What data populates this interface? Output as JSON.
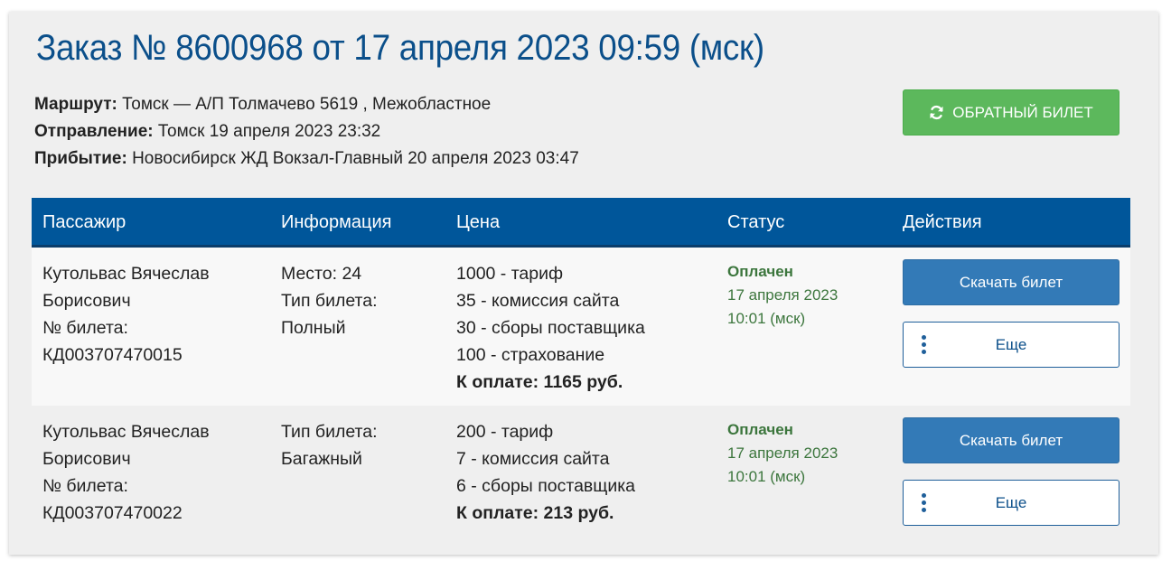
{
  "order": {
    "title": "Заказ № 8600968 от 17 апреля 2023 09:59 (мск)",
    "route_label": "Маршрут:",
    "route_value": "Томск — А/П Толмачево 5619 , Межобластное",
    "departure_label": "Отправление:",
    "departure_value": "Томск 19 апреля 2023 23:32",
    "arrival_label": "Прибытие:",
    "arrival_value": "Новосибирск ЖД Вокзал-Главный 20 апреля 2023 03:47",
    "return_button_label": "ОБРАТНЫЙ БИЛЕТ",
    "return_button_icon": "refresh-icon"
  },
  "table": {
    "headers": {
      "passenger": "Пассажир",
      "info": "Информация",
      "price": "Цена",
      "status": "Статус",
      "actions": "Действия"
    },
    "rows": [
      {
        "passenger": [
          "Кутольвас Вячеслав",
          "Борисович",
          "№ билета:",
          "КД003707470015"
        ],
        "info": [
          "Место: 24",
          "Тип билета:",
          "Полный"
        ],
        "price": [
          "1000 - тариф",
          "35 - комиссия сайта",
          "30 - сборы поставщика",
          "100 - страхование"
        ],
        "total": "К оплате: 1165 руб.",
        "status": "Оплачен",
        "status_date": "17 апреля 2023",
        "status_time": "10:01 (мск)",
        "download_label": "Скачать билет",
        "more_label": "Еще"
      },
      {
        "passenger": [
          "Кутольвас Вячеслав",
          "Борисович",
          "№ билета:",
          "КД003707470022"
        ],
        "info": [
          "Тип билета:",
          "Багажный"
        ],
        "price": [
          "200 - тариф",
          "7 - комиссия сайта",
          "6 - сборы поставщика"
        ],
        "total": "К оплате: 213 руб.",
        "status": "Оплачен",
        "status_date": "17 апреля 2023",
        "status_time": "10:01 (мск)",
        "download_label": "Скачать билет",
        "more_label": "Еще"
      }
    ]
  },
  "colors": {
    "title": "#0b4f8a",
    "header_bg": "#00569a",
    "success_button": "#5cb85c",
    "primary_button": "#337ab7",
    "status_paid": "#3c763d"
  }
}
